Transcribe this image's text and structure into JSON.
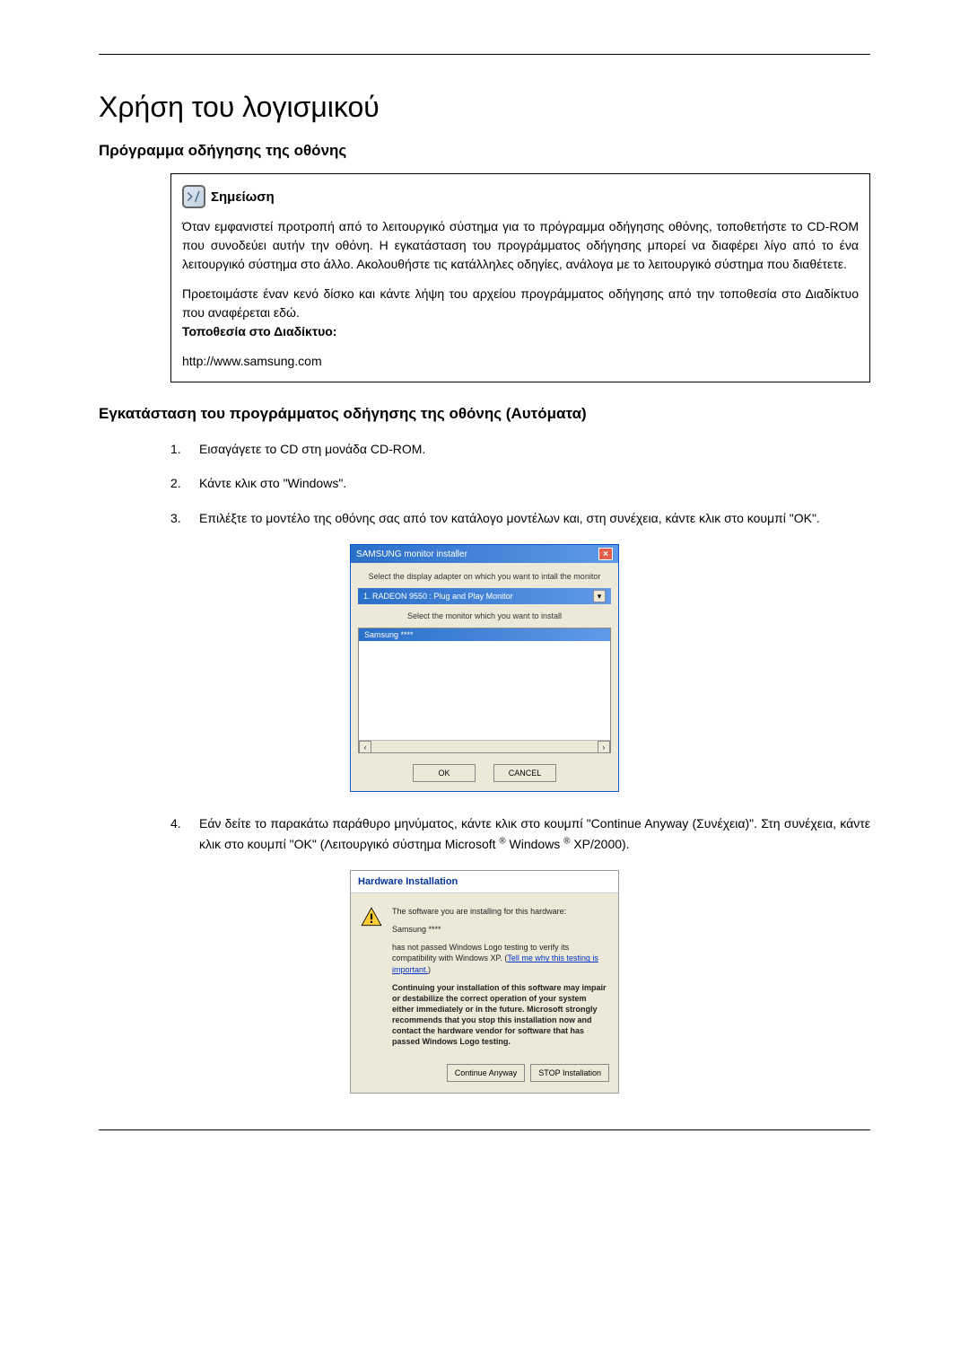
{
  "title": "Χρήση του λογισμικού",
  "section1_title": "Πρόγραμμα οδήγησης της οθόνης",
  "note": {
    "label": "Σημείωση",
    "para1": "Όταν εμφανιστεί προτροπή από το λειτουργικό σύστημα για το πρόγραμμα οδήγησης οθόνης, τοποθετήστε το CD-ROM που συνοδεύει αυτήν την οθόνη. Η εγκατάσταση του προγράμματος οδήγησης μπορεί να διαφέρει λίγο από το ένα λειτουργικό σύστημα στο άλλο. Ακολουθήστε τις κατάλληλες οδηγίες, ανάλογα με το λειτουργικό σύστημα που διαθέτετε.",
    "para2": "Προετοιμάστε έναν κενό δίσκο και κάντε λήψη του αρχείου προγράμματος οδήγησης από την τοποθεσία στο Διαδίκτυο που αναφέρεται εδώ.",
    "internet_label": "Τοποθεσία στο Διαδίκτυο:",
    "url": "http://www.samsung.com"
  },
  "section2_title": "Εγκατάσταση του προγράμματος οδήγησης της οθόνης (Αυτόματα)",
  "steps": {
    "s1_num": "1.",
    "s1_text": "Εισαγάγετε το CD στη μονάδα CD-ROM.",
    "s2_num": "2.",
    "s2_text": "Κάντε κλικ στο \"Windows\".",
    "s3_num": "3.",
    "s3_text": "Επιλέξτε το μοντέλο της οθόνης σας από τον κατάλογο μοντέλων και, στη συνέχεια, κάντε κλικ στο κουμπί \"OK\".",
    "s4_num": "4.",
    "s4_text_a": "Εάν δείτε το παρακάτω παράθυρο μηνύματος, κάντε κλικ στο κουμπί \"Continue Anyway (Συνέχεια)\". Στη συνέχεια, κάντε κλικ στο κουμπί \"OK\" (Λειτουργικό σύστημα Microsoft ",
    "s4_text_b": " Windows ",
    "s4_text_c": " XP/2000)."
  },
  "dialog1": {
    "title": "SAMSUNG monitor installer",
    "instr1": "Select the display adapter on which you want to intall the monitor",
    "dropdown": "1. RADEON 9550 : Plug and Play Monitor",
    "instr2": "Select the monitor which you want to install",
    "listitem": "Samsung ****",
    "ok": "OK",
    "cancel": "CANCEL"
  },
  "dialog2": {
    "title": "Hardware Installation",
    "line1": "The software you are installing for this hardware:",
    "line2": "Samsung ****",
    "line3a": "has not passed Windows Logo testing to verify its compatibility with Windows XP. (",
    "line3_link": "Tell me why this testing is important.",
    "line3b": ")",
    "bold_para": "Continuing your installation of this software may impair or destabilize the correct operation of your system either immediately or in the future. Microsoft strongly recommends that you stop this installation now and contact the hardware vendor for software that has passed Windows Logo testing.",
    "btn_continue": "Continue Anyway",
    "btn_stop": "STOP Installation"
  }
}
